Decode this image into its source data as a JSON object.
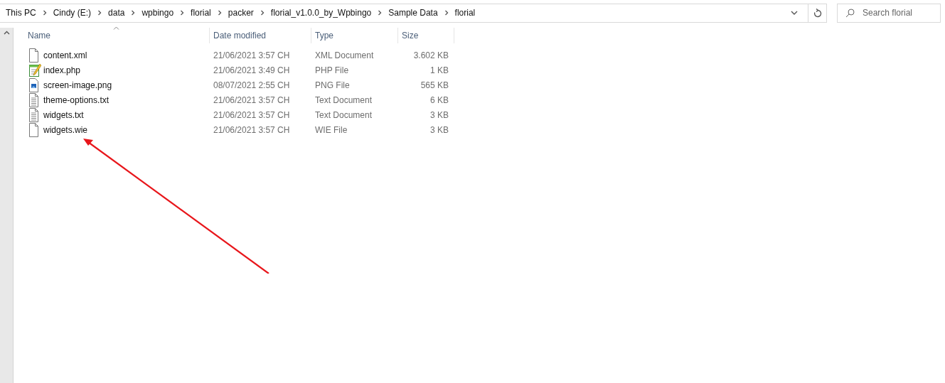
{
  "address_bar": {
    "path": [
      "This PC",
      "Cindy (E:)",
      "data",
      "wpbingo",
      "florial",
      "packer",
      "florial_v1.0.0_by_Wpbingo",
      "Sample Data",
      "florial"
    ]
  },
  "search": {
    "placeholder": "Search florial"
  },
  "table": {
    "columns": [
      {
        "label": "Name",
        "sorted": true
      },
      {
        "label": "Date modified",
        "sorted": false
      },
      {
        "label": "Type",
        "sorted": false
      },
      {
        "label": "Size",
        "sorted": false
      }
    ],
    "rows": [
      {
        "kind": "blank",
        "name": "content.xml",
        "date": "21/06/2021 3:57 CH",
        "type": "XML Document",
        "size": "3.602 KB"
      },
      {
        "kind": "php",
        "name": "index.php",
        "date": "21/06/2021 3:49 CH",
        "type": "PHP File",
        "size": "1 KB"
      },
      {
        "kind": "image",
        "name": "screen-image.png",
        "date": "08/07/2021 2:55 CH",
        "type": "PNG File",
        "size": "565 KB"
      },
      {
        "kind": "text",
        "name": "theme-options.txt",
        "date": "21/06/2021 3:57 CH",
        "type": "Text Document",
        "size": "6 KB"
      },
      {
        "kind": "text",
        "name": "widgets.txt",
        "date": "21/06/2021 3:57 CH",
        "type": "Text Document",
        "size": "3 KB"
      },
      {
        "kind": "blank",
        "name": "widgets.wie",
        "date": "21/06/2021 3:57 CH",
        "type": "WIE File",
        "size": "3 KB"
      }
    ]
  }
}
